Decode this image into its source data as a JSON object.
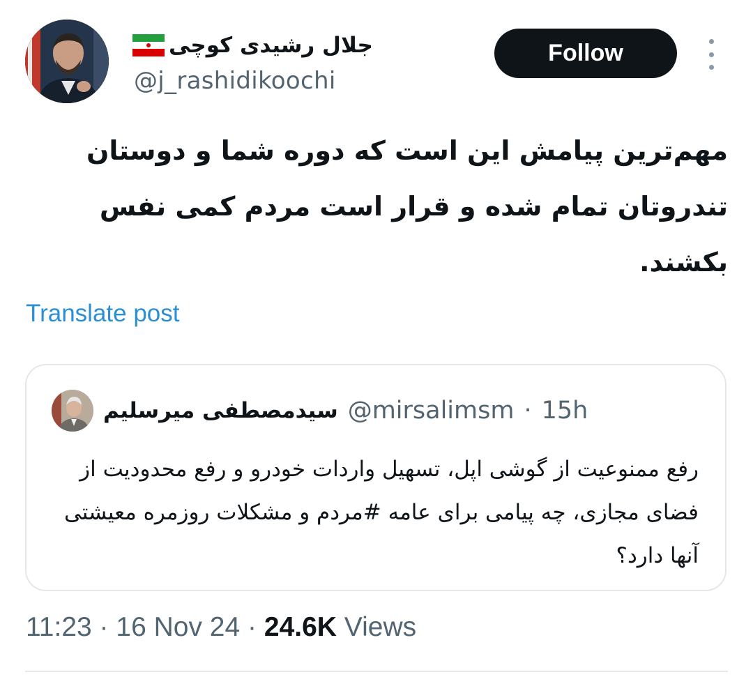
{
  "author": {
    "name": "جلال رشیدی کوچی",
    "flag_emoji": "iran-flag-icon",
    "handle": "@j_rashidikoochi"
  },
  "actions": {
    "follow_label": "Follow",
    "more_icon": "more-vertical-icon"
  },
  "tweet": {
    "text": "مهم‌ترین پیامش این است که دوره شما و دوستان تندروتان تمام شده و قرار است مردم کمی نفس بکشند.",
    "translate_label": "Translate post"
  },
  "quoted": {
    "name": "سیدمصطفی میرسلیم",
    "handle": "@mirsalimsm",
    "separator": "·",
    "time": "15h",
    "text": "رفع ممنوعیت از گوشی اپل، تسهیل واردات خودرو و رفع محدودیت از فضای مجازی، چه پیامی برای عامه #مردم و مشکلات روزمره معیشتی آنها دارد؟"
  },
  "meta": {
    "time": "11:23",
    "separator": "·",
    "date": "16 Nov 24",
    "views_count": "24.6K",
    "views_label": "Views"
  },
  "colors": {
    "text": "#0f1419",
    "secondary": "#536471",
    "link": "#2b8fd4",
    "border": "#e3e8ec",
    "follow_bg": "#0f1419"
  }
}
